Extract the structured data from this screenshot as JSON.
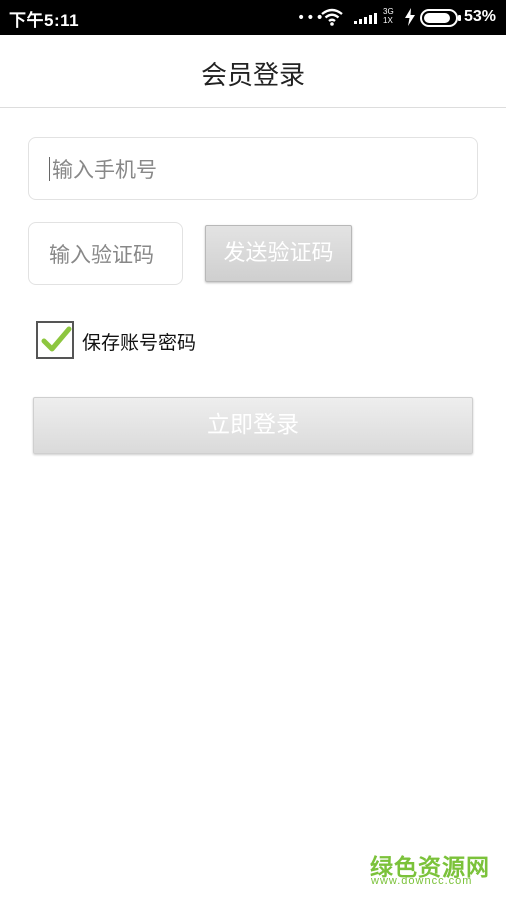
{
  "status_bar": {
    "time": "下午5:11",
    "dots": "•••",
    "network_top": "3G",
    "network_bottom": "1X",
    "battery_percent": "53%"
  },
  "header": {
    "title": "会员登录"
  },
  "form": {
    "phone_placeholder": "输入手机号",
    "code_placeholder": "输入验证码",
    "send_code_label": "发送验证码",
    "remember_label": "保存账号密码",
    "remember_checked": true,
    "login_label": "立即登录"
  },
  "watermark": {
    "title": "绿色资源网",
    "url": "www.downcc.com"
  },
  "colors": {
    "status_bar_bg": "#000000",
    "check_mark": "#8dc63f",
    "watermark": "#7bc23a",
    "button_text": "#ffffff"
  },
  "icons": [
    "wifi-icon",
    "signal-icon",
    "charging-icon",
    "battery-icon",
    "checkmark-icon"
  ]
}
